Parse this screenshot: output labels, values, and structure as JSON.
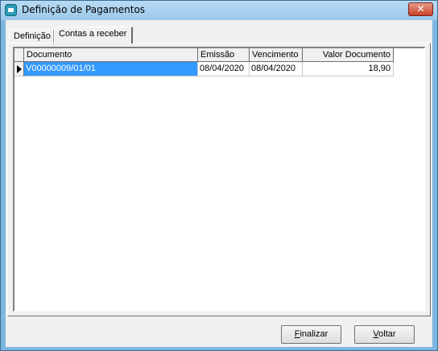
{
  "window": {
    "title": "Definição de Pagamentos",
    "close_label": "✕"
  },
  "tabs": [
    {
      "label": "Definição",
      "active": false
    },
    {
      "label": "Contas a receber",
      "active": true
    }
  ],
  "grid": {
    "columns": [
      "Documento",
      "Emissão",
      "Vencimento",
      "Valor Documento"
    ],
    "rows": [
      {
        "documento": "V00000009/01/01",
        "emissao": "08/04/2020",
        "vencimento": "08/04/2020",
        "valor": "18,90"
      }
    ]
  },
  "buttons": {
    "finalizar": {
      "accel": "F",
      "rest": "inalizar"
    },
    "voltar": {
      "accel": "V",
      "rest": "oltar"
    }
  },
  "colors": {
    "title_bar": "#9cc8ea",
    "selection": "#3399ff",
    "close_button": "#c8432a"
  }
}
